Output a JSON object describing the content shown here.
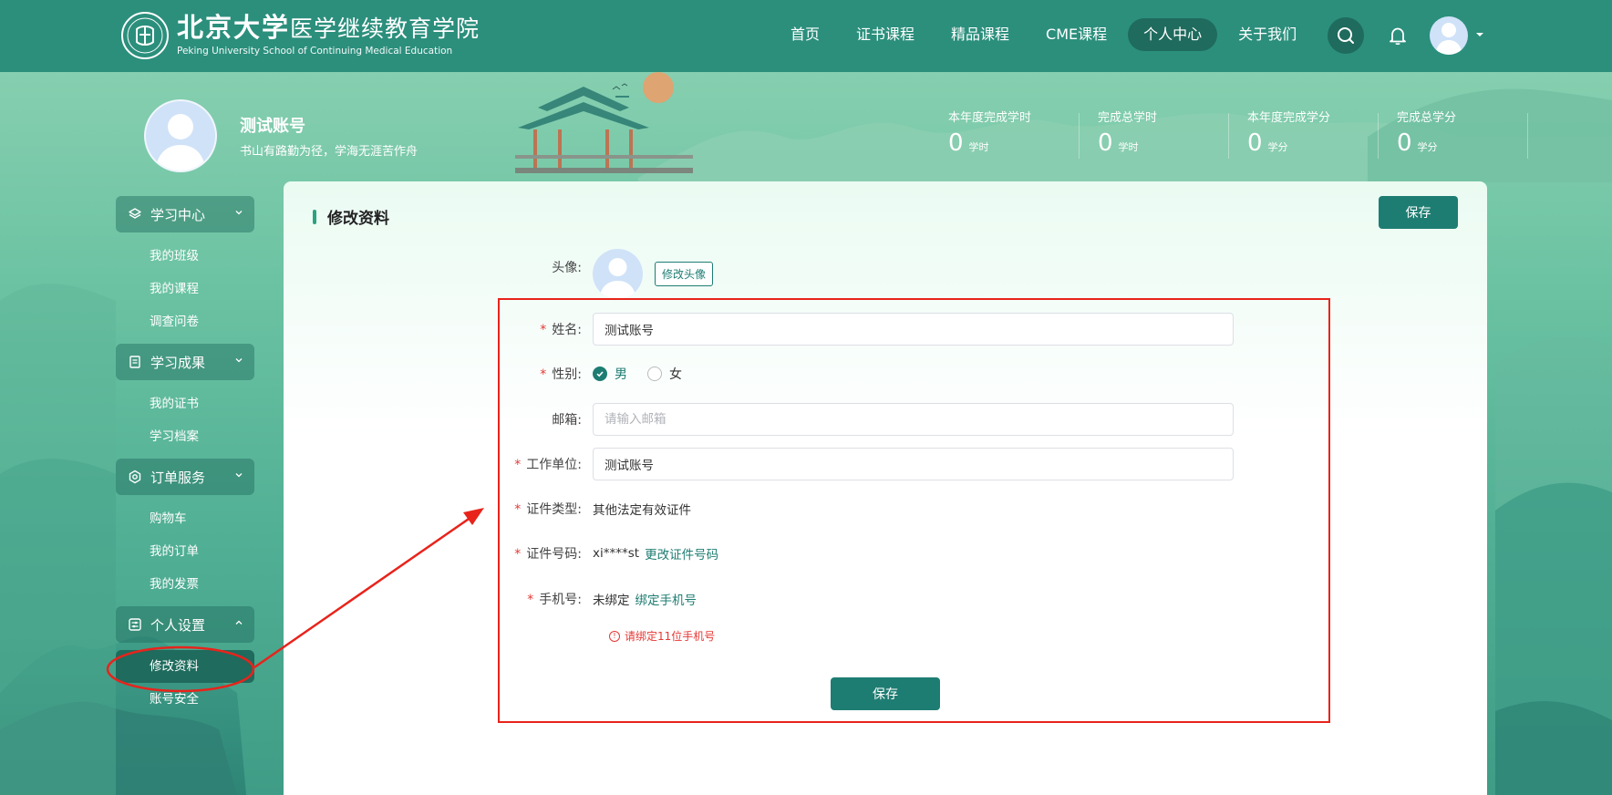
{
  "header": {
    "logo_cn": "北京大学医学继续教育学院",
    "logo_cn_brand": "北京大学",
    "logo_cn_sub": "医学继续教育学院",
    "logo_en": "Peking University School of Continuing Medical Education",
    "nav": [
      {
        "label": "首页"
      },
      {
        "label": "证书课程"
      },
      {
        "label": "精品课程"
      },
      {
        "label": "CME课程"
      },
      {
        "label": "个人中心",
        "active": true
      },
      {
        "label": "关于我们"
      }
    ],
    "icons": [
      "search-icon",
      "bell-icon",
      "user-avatar",
      "caret-down-icon"
    ]
  },
  "profile": {
    "name": "测试账号",
    "motto": "书山有路勤为径，学海无涯苦作舟"
  },
  "stats": [
    {
      "label": "本年度完成学时",
      "value": "0",
      "unit": "学时"
    },
    {
      "label": "完成总学时",
      "value": "0",
      "unit": "学时"
    },
    {
      "label": "本年度完成学分",
      "value": "0",
      "unit": "学分"
    },
    {
      "label": "完成总学分",
      "value": "0",
      "unit": "学分"
    }
  ],
  "sidebar": {
    "groups": [
      {
        "label": "学习中心",
        "icon": "layers-icon",
        "expanded": true,
        "items": [
          "我的班级",
          "我的课程",
          "调查问卷"
        ]
      },
      {
        "label": "学习成果",
        "icon": "document-icon",
        "expanded": true,
        "items": [
          "我的证书",
          "学习档案"
        ]
      },
      {
        "label": "订单服务",
        "icon": "settings-hex-icon",
        "expanded": true,
        "items": [
          "购物车",
          "我的订单",
          "我的发票"
        ]
      },
      {
        "label": "个人设置",
        "icon": "sliders-icon",
        "expanded": true,
        "items": [
          "修改资料",
          "账号安全"
        ],
        "active_item": "修改资料"
      }
    ]
  },
  "form": {
    "title": "修改资料",
    "save_top": "保存",
    "avatar_label": "头像:",
    "avatar_button": "修改头像",
    "name_label": "姓名:",
    "name_value": "测试账号",
    "gender_label": "性别:",
    "gender_options": [
      "男",
      "女"
    ],
    "gender_selected": "男",
    "email_label": "邮箱:",
    "email_value": "",
    "email_placeholder": "请输入邮箱",
    "work_label": "工作单位:",
    "work_value": "测试账号",
    "idtype_label": "证件类型:",
    "idtype_value": "其他法定有效证件",
    "idnum_label": "证件号码:",
    "idnum_value": "xi****st",
    "idnum_link": "更改证件号码",
    "phone_label": "手机号:",
    "phone_value": "未绑定",
    "phone_link": "绑定手机号",
    "phone_error": "请绑定11位手机号",
    "save_bottom": "保存",
    "required_mark": "*"
  },
  "colors": {
    "header_bg": "#2b8f7c",
    "nav_active": "#1f6b5d",
    "primary": "#1e7d72",
    "annotation": "#e8231b",
    "error": "#e53935"
  }
}
